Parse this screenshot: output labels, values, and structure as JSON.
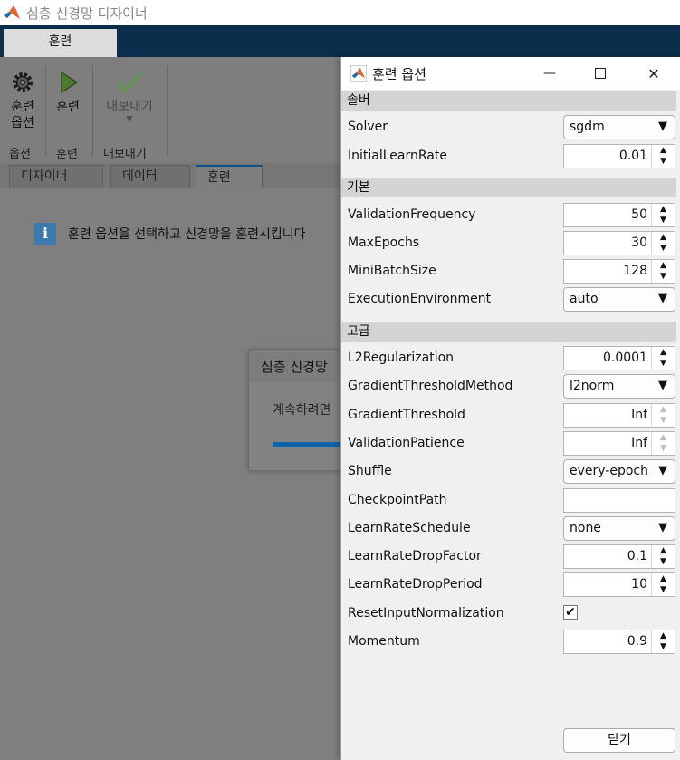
{
  "window": {
    "title": "심층 신경망 디자이너"
  },
  "ribbon": {
    "tab": "훈련",
    "tools": {
      "train_options": {
        "label1": "훈련",
        "label2": "옵션"
      },
      "train": {
        "label": "훈련"
      },
      "export": {
        "label": "내보내기"
      }
    },
    "sections": {
      "options": "옵션",
      "train": "훈련",
      "export": "내보내기"
    }
  },
  "doc_tabs": [
    "디자이너",
    "데이터",
    "훈련"
  ],
  "content": {
    "info_text": "훈련 옵션을 선택하고 신경망을 훈련시킵니다",
    "progress_title": "심층 신경망",
    "progress_message": "계속하려면"
  },
  "dialog": {
    "title": "훈련 옵션",
    "sections": {
      "solver": "솔버",
      "basic": "기본",
      "advanced": "고급"
    },
    "fields": {
      "solver": {
        "label": "Solver",
        "value": "sgdm"
      },
      "initial_learn_rate": {
        "label": "InitialLearnRate",
        "value": "0.01"
      },
      "validation_frequency": {
        "label": "ValidationFrequency",
        "value": "50"
      },
      "max_epochs": {
        "label": "MaxEpochs",
        "value": "30"
      },
      "mini_batch_size": {
        "label": "MiniBatchSize",
        "value": "128"
      },
      "execution_environment": {
        "label": "ExecutionEnvironment",
        "value": "auto"
      },
      "l2_regularization": {
        "label": "L2Regularization",
        "value": "0.0001"
      },
      "gradient_threshold_method": {
        "label": "GradientThresholdMethod",
        "value": "l2norm"
      },
      "gradient_threshold": {
        "label": "GradientThreshold",
        "value": "Inf"
      },
      "validation_patience": {
        "label": "ValidationPatience",
        "value": "Inf"
      },
      "shuffle": {
        "label": "Shuffle",
        "value": "every-epoch"
      },
      "checkpoint_path": {
        "label": "CheckpointPath",
        "value": ""
      },
      "learn_rate_schedule": {
        "label": "LearnRateSchedule",
        "value": "none"
      },
      "learn_rate_drop_factor": {
        "label": "LearnRateDropFactor",
        "value": "0.1"
      },
      "learn_rate_drop_period": {
        "label": "LearnRateDropPeriod",
        "value": "10"
      },
      "reset_input_normalization": {
        "label": "ResetInputNormalization",
        "checked": true
      },
      "momentum": {
        "label": "Momentum",
        "value": "0.9"
      }
    },
    "close_label": "닫기"
  },
  "glyphs": {
    "caret": "▼",
    "up": "▲",
    "down": "▼",
    "check": "✔",
    "minimize": "—",
    "close": "✕"
  },
  "colors": {
    "accent": "#0a62a8",
    "titlebar_dark": "#0c2d4b",
    "info": "#3a78ad"
  }
}
